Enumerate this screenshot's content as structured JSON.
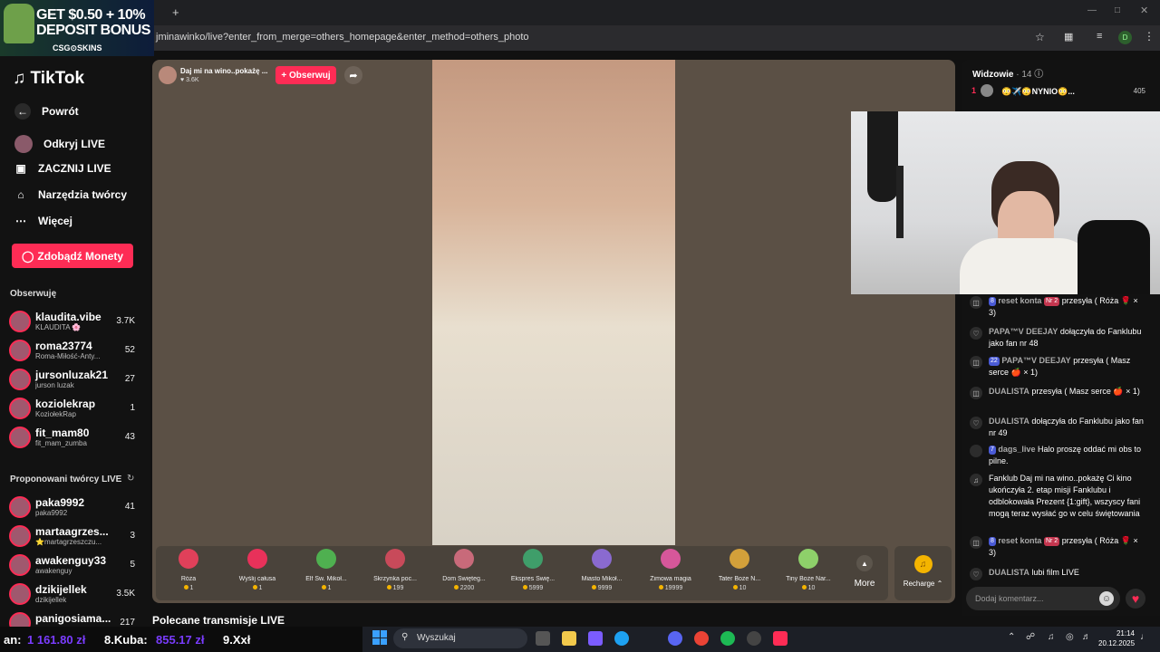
{
  "promo": {
    "line1": "GET $0.50 + 10%",
    "line2": "DEPOSIT BONUS",
    "brand": "CSG⊙SKINS"
  },
  "browser": {
    "url": "jminawinko/live?enter_from_merge=others_homepage&enter_method=others_photo",
    "new_tab": "+",
    "profile": "D"
  },
  "sidebar": {
    "logo": "TikTok",
    "nav": [
      {
        "label": "Powrót",
        "icon": "back-arrow-icon"
      },
      {
        "label": "Odkryj LIVE",
        "icon": "live-avatar-icon"
      },
      {
        "label": "ZACZNIJ LIVE",
        "icon": "camera-icon"
      },
      {
        "label": "Narzędzia twórcy",
        "icon": "house-icon"
      },
      {
        "label": "Więcej",
        "icon": "more-dots-icon"
      }
    ],
    "coins_button": "Zdobądź Monety",
    "following_header": "Obserwuję",
    "following": [
      {
        "name": "klaudita.vibe",
        "sub": "KLAUDITA 🌸",
        "count": "3.7K"
      },
      {
        "name": "roma23774",
        "sub": "Roma-Miłość-Anty...",
        "count": "52"
      },
      {
        "name": "jursonluzak21",
        "sub": "jurson luzak",
        "count": "27"
      },
      {
        "name": "koziolekrap",
        "sub": "KoziołekRap",
        "count": "1"
      },
      {
        "name": "fit_mam80",
        "sub": "fit_mam_zumba",
        "count": "43"
      }
    ],
    "suggested_header": "Proponowani twórcy LIVE",
    "suggested": [
      {
        "name": "paka9992",
        "sub": "paka9992",
        "count": "41"
      },
      {
        "name": "martaagrzes...",
        "sub": "⭐martagrzeszczu...",
        "count": "3"
      },
      {
        "name": "awakenguy33",
        "sub": "awakenguy",
        "count": "5"
      },
      {
        "name": "dzikijellek",
        "sub": "dzikijellek",
        "count": "3.5K"
      },
      {
        "name": "panigosiama...",
        "sub": "",
        "count": "217"
      }
    ]
  },
  "stream": {
    "title": "Daj mi na wino..pokażę ...",
    "likes": "♥ 3.6K",
    "follow_label": "+ Obserwuj",
    "recommended": "Polecane transmisje LIVE"
  },
  "gifts": [
    {
      "name": "Róża",
      "price": "1",
      "color": "#e0405a"
    },
    {
      "name": "Wyślij całusa",
      "price": "1",
      "color": "#e8315a"
    },
    {
      "name": "Elf Św. Mikoł...",
      "price": "1",
      "color": "#4fb050"
    },
    {
      "name": "Skrzynka poc...",
      "price": "199",
      "color": "#c84a5a"
    },
    {
      "name": "Dom Święteg...",
      "price": "2200",
      "color": "#c86a7a"
    },
    {
      "name": "Ekspres Świę...",
      "price": "5999",
      "color": "#3f9e6a"
    },
    {
      "name": "Miasto Mikoł...",
      "price": "9999",
      "color": "#8a6ad0"
    },
    {
      "name": "Zimowa magia",
      "price": "19999",
      "color": "#d6579a"
    },
    {
      "name": "Tater Boże N...",
      "price": "10",
      "color": "#d3a03a"
    },
    {
      "name": "Tiny Boże Nar...",
      "price": "10",
      "color": "#8ed06a"
    }
  ],
  "more_label": "More",
  "recharge_label": "Recharge ⌃",
  "viewers": {
    "label": "Widzowie",
    "count": "· 14",
    "top_rank": "1",
    "top_name": "😳✈️😳NYNIO😳...",
    "top_score": "405"
  },
  "chat": [
    {
      "icon": "gift",
      "badge": "8",
      "badge2": "Nr 2",
      "user": "reset konta",
      "text": "przesyła ( Róża 🌹 × 3)"
    },
    {
      "icon": "heart",
      "badge": "",
      "badge2": "",
      "user": "PAPA™V DEEJAY",
      "text": "dołączyła do Fanklubu jako fan nr 48"
    },
    {
      "icon": "gift",
      "badge": "22",
      "badge2": "",
      "user": "PAPA™V DEEJAY",
      "text": "przesyła ( Masz serce 🍎 × 1)"
    },
    {
      "icon": "gift",
      "badge": "",
      "badge2": "",
      "user": "DUALISTA",
      "text": "przesyła ( Masz serce 🍎 × 1)"
    },
    {
      "icon": "heart",
      "badge": "",
      "badge2": "",
      "user": "DUALISTA",
      "text": "dołączyła do Fanklubu jako fan nr 49"
    },
    {
      "icon": "avatar",
      "badge": "7",
      "badge2": "",
      "user": "dags_live",
      "text": "Halo proszę oddać mi obs to pilne."
    },
    {
      "icon": "tiktok",
      "badge": "",
      "badge2": "",
      "user": "",
      "text": "Fanklub Daj mi na wino..pokażę Ci kino ukończyła 2. etap misji Fanklubu i odblokowała Prezent {1:gift}, wszyscy fani mogą teraz wysłać go w celu świętowania"
    },
    {
      "icon": "gift",
      "badge": "8",
      "badge2": "Nr 2",
      "user": "reset konta",
      "text": "przesyła ( Róża 🌹 × 3)"
    },
    {
      "icon": "heart",
      "badge": "",
      "badge2": "",
      "user": "DUALISTA",
      "text": "lubi film LIVE"
    }
  ],
  "comment_placeholder": "Dodaj komentarz...",
  "ticker": [
    {
      "label": "an:",
      "value": "1 161.80 zł"
    },
    {
      "label": "8.Kuba:",
      "value": "855.17 zł"
    },
    {
      "label": "9.Xxł",
      "value": ""
    }
  ],
  "taskbar": {
    "search": "Wyszukaj",
    "time": "21:14",
    "date": "20.12.2025"
  },
  "colors": {
    "accent": "#fe2c55",
    "ticker_value": "#7a3cff",
    "stage_bg": "#5b5045"
  }
}
